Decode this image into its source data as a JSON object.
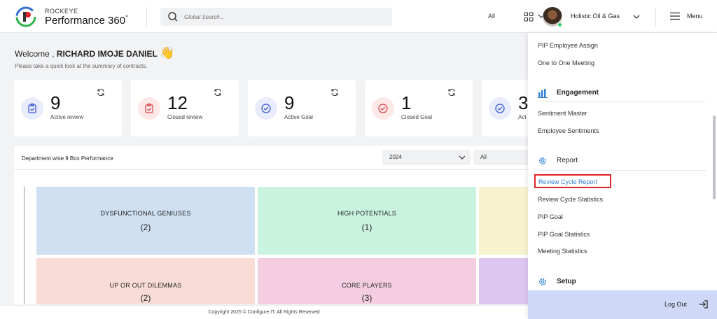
{
  "header": {
    "brand_top": "ROCKEYE",
    "brand_main": "Performance 360",
    "brand_sup": "°",
    "search_placeholder": "Global Search...",
    "search_scope": "All",
    "company": "Holistic Oil & Gas",
    "menu_label": "Menu"
  },
  "welcome": {
    "greeting": "Welcome , ",
    "name": "RICHARD IMOJE DANIEL",
    "wave": "👋",
    "subtitle": "Please take a quick look at the summary of contracts."
  },
  "cards": [
    {
      "value": "9",
      "label": "Active review",
      "color": "#e8ecfb",
      "icon_color": "#3d5bd9",
      "icon": "clipboard-check-icon"
    },
    {
      "value": "12",
      "label": "Closed review",
      "color": "#fde8e8",
      "icon_color": "#d94a4a",
      "icon": "clipboard-check-icon"
    },
    {
      "value": "9",
      "label": "Active Goal",
      "color": "#e8ecfb",
      "icon_color": "#3d5bd9",
      "icon": "check-circle-icon"
    },
    {
      "value": "1",
      "label": "Closed Goal",
      "color": "#fde8e8",
      "icon_color": "#d94a4a",
      "icon": "check-circle-icon"
    },
    {
      "value": "3",
      "label": "Act",
      "color": "#e8ecfb",
      "icon_color": "#3d5bd9",
      "icon": "check-circle-icon"
    }
  ],
  "panel": {
    "title": "Department wise 9 Box Performance",
    "year": "2024",
    "filter": "All",
    "boxes": [
      {
        "name": "DYSFUNCTIONAL GENIUSES",
        "count": "(2)",
        "color": "#cfe0f3"
      },
      {
        "name": "HIGH POTENTIALS",
        "count": "(1)",
        "color": "#c9f3df"
      },
      {
        "name": "",
        "count": "",
        "color": "#f8f3cf"
      },
      {
        "name": "UP OR OUT DILEMMAS",
        "count": "(2)",
        "color": "#f8dcd5"
      },
      {
        "name": "CORE PLAYERS",
        "count": "(3)",
        "color": "#f4cee0"
      },
      {
        "name": "",
        "count": "",
        "color": "#dcc7f1"
      }
    ]
  },
  "sidemenu": {
    "items_top": [
      "PIP Employee Assign",
      "One to One Meeting"
    ],
    "engagement": {
      "label": "Engagement",
      "items": [
        "Sentiment Master",
        "Employee Sentiments"
      ]
    },
    "report": {
      "label": "Report",
      "active": "Review Cycle Report",
      "items": [
        "Review Cycle Statistics",
        "PIP Goal",
        "PIP Goal Statistics",
        "Meeting Statistics"
      ]
    },
    "setup": {
      "label": "Setup"
    },
    "logout": "Log Out"
  },
  "footer": "Copyright 2025 © Configure.IT. All Rights Reserved"
}
